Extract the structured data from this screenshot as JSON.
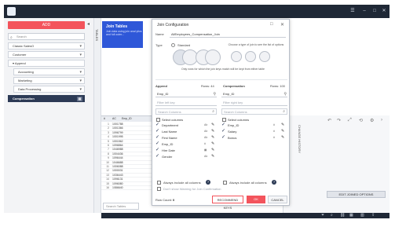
{
  "topbar": {
    "tabs": [
      "",
      "",
      "",
      "",
      ""
    ],
    "icons": [
      "menu-icon",
      "minimize-icon",
      "maximize-icon",
      "close-icon"
    ]
  },
  "sidebar": {
    "add_label": "ADD",
    "search_placeholder": "Search",
    "items": [
      {
        "label": "Classic SalesO",
        "level": 0
      },
      {
        "label": "Customer",
        "level": 0
      },
      {
        "label": "Append",
        "level": 1
      },
      {
        "label": "Accounting",
        "level": 2
      },
      {
        "label": "Marketing",
        "level": 2
      },
      {
        "label": "Data Processing",
        "level": 2
      },
      {
        "label": "Compensation",
        "level": 0,
        "active": true
      }
    ],
    "vertical_label": "TABLES"
  },
  "canvas": {
    "node_title": "Join Tables",
    "node_desc": "Join data using join anal ytics and full outer..."
  },
  "grid": {
    "header": [
      "#",
      "AC",
      "Emp_ID"
    ],
    "rows": [
      {
        "n": "1",
        "v": "1001788"
      },
      {
        "n": "2",
        "v": "1001366"
      },
      {
        "n": "3",
        "v": "1096799"
      },
      {
        "n": "4",
        "v": "1001995"
      },
      {
        "n": "5",
        "v": "1001562"
      },
      {
        "n": "6",
        "v": "1096864"
      },
      {
        "n": "7",
        "v": "1046988"
      },
      {
        "n": "8",
        "v": "1004436"
      },
      {
        "n": "9",
        "v": "1096444"
      },
      {
        "n": "10",
        "v": "1046688"
      },
      {
        "n": "11",
        "v": "1006088"
      },
      {
        "n": "12",
        "v": "1000031"
      },
      {
        "n": "13",
        "v": "1036443"
      },
      {
        "n": "14",
        "v": "1096131"
      },
      {
        "n": "15",
        "v": "1096080"
      },
      {
        "n": "16",
        "v": "1086640"
      }
    ],
    "search_placeholder": "Search Tables"
  },
  "right_panel": {
    "label": "CHANGE HISTORY",
    "edit_options": "EDIT JOINED OPTIONS"
  },
  "dialog": {
    "title": "Join Configuration",
    "name_label": "Name",
    "name_value": "AllEmployees_Compensation_Join",
    "type_label": "Type",
    "type_option": "Standard",
    "type_hint": "Choose a type of join to see the list of options",
    "venn_hint": "Only rows for which the join keys match will be kept from either table",
    "append_title": "Append",
    "append_rows": "Rows: 44",
    "comp_title": "Compensation",
    "comp_rows": "Rows: 100",
    "left_key": "Emp_ID",
    "right_key": "Emp_ID",
    "left_key_ph": "Filter left key",
    "right_key_ph": "Filter right key",
    "search_columns": "Search Columns",
    "select_columns": "Select columns",
    "left_columns": [
      "Department",
      "Last Name",
      "First Name",
      "Emp_ID",
      "Hire Date",
      "Gender"
    ],
    "right_columns": [
      "Emp_ID",
      "Salary",
      "Bonus"
    ],
    "always_include": "Always include all columns",
    "dont_show": "Don't show Warning for Join Confirmation",
    "row_count_label": "Row Count:",
    "row_count": "0",
    "recommend_label": "RECOMMEND KEYS",
    "ok_label": "OK",
    "cancel_label": "CANCEL"
  },
  "colors": {
    "accent": "#f3545c",
    "node_blue": "#2e57d8",
    "dark": "#1f2836",
    "active_item": "#2c3a55"
  }
}
